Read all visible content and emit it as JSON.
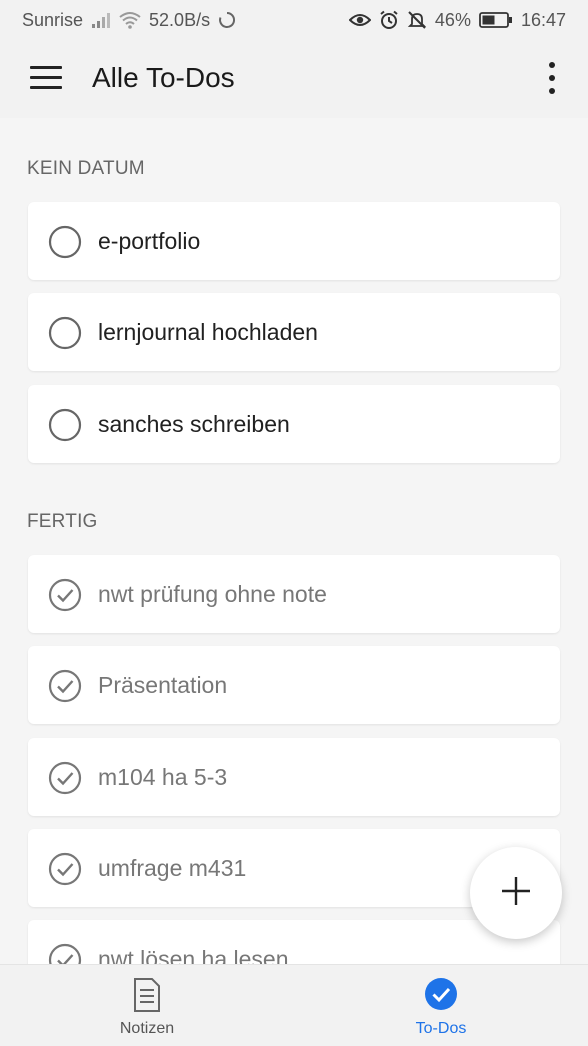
{
  "status_bar": {
    "carrier": "Sunrise",
    "speed": "52.0B/s",
    "battery": "46%",
    "time": "16:47"
  },
  "app_bar": {
    "title": "Alle To-Dos",
    "menu_icon": "hamburger-menu-icon",
    "more_icon": "more-vert-icon"
  },
  "sections": [
    {
      "header": "KEIN DATUM",
      "items": [
        {
          "label": "e-portfolio",
          "done": false
        },
        {
          "label": "lernjournal hochladen",
          "done": false
        },
        {
          "label": "sanches schreiben",
          "done": false
        }
      ]
    },
    {
      "header": "FERTIG",
      "items": [
        {
          "label": "nwt prüfung ohne note",
          "done": true
        },
        {
          "label": "Präsentation",
          "done": true
        },
        {
          "label": "m104 ha 5-3",
          "done": true
        },
        {
          "label": "umfrage m431",
          "done": true
        },
        {
          "label": "nwt lösen ha lesen",
          "done": true
        }
      ]
    }
  ],
  "fab": {
    "icon": "plus-icon"
  },
  "bottom_nav": [
    {
      "label": "Notizen",
      "icon": "note-icon",
      "active": false
    },
    {
      "label": "To-Dos",
      "icon": "check-circle-icon",
      "active": true
    }
  ],
  "colors": {
    "accent": "#1e73e8",
    "background": "#f5f5f5",
    "card": "#ffffff"
  }
}
